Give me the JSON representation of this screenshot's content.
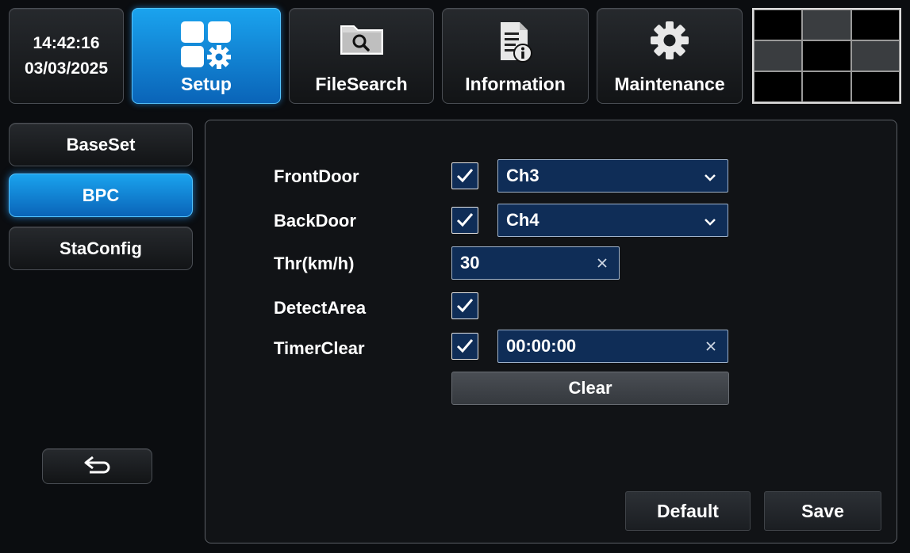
{
  "clock": {
    "time": "14:42:16",
    "date": "03/03/2025"
  },
  "topnav": [
    {
      "label": "Setup",
      "icon": "setup-icon",
      "active": true
    },
    {
      "label": "FileSearch",
      "icon": "file-search-icon",
      "active": false
    },
    {
      "label": "Information",
      "icon": "information-icon",
      "active": false
    },
    {
      "label": "Maintenance",
      "icon": "gear-icon",
      "active": false
    }
  ],
  "sidebar": {
    "items": [
      {
        "label": "BaseSet",
        "active": false
      },
      {
        "label": "BPC",
        "active": true
      },
      {
        "label": "StaConfig",
        "active": false
      }
    ],
    "back_icon": "back-arrow-icon"
  },
  "form": {
    "front_door": {
      "label": "FrontDoor",
      "checked": true,
      "value": "Ch3"
    },
    "back_door": {
      "label": "BackDoor",
      "checked": true,
      "value": "Ch4"
    },
    "threshold": {
      "label": "Thr(km/h)",
      "value": "30"
    },
    "detect_area": {
      "label": "DetectArea",
      "checked": true
    },
    "timer_clear": {
      "label": "TimerClear",
      "checked": true,
      "value": "00:00:00"
    },
    "clear_label": "Clear"
  },
  "actions": {
    "default_label": "Default",
    "save_label": "Save"
  },
  "colors": {
    "accent": "#1a8fe0",
    "field_bg": "#0f2d57",
    "background": "#0b0d10"
  }
}
